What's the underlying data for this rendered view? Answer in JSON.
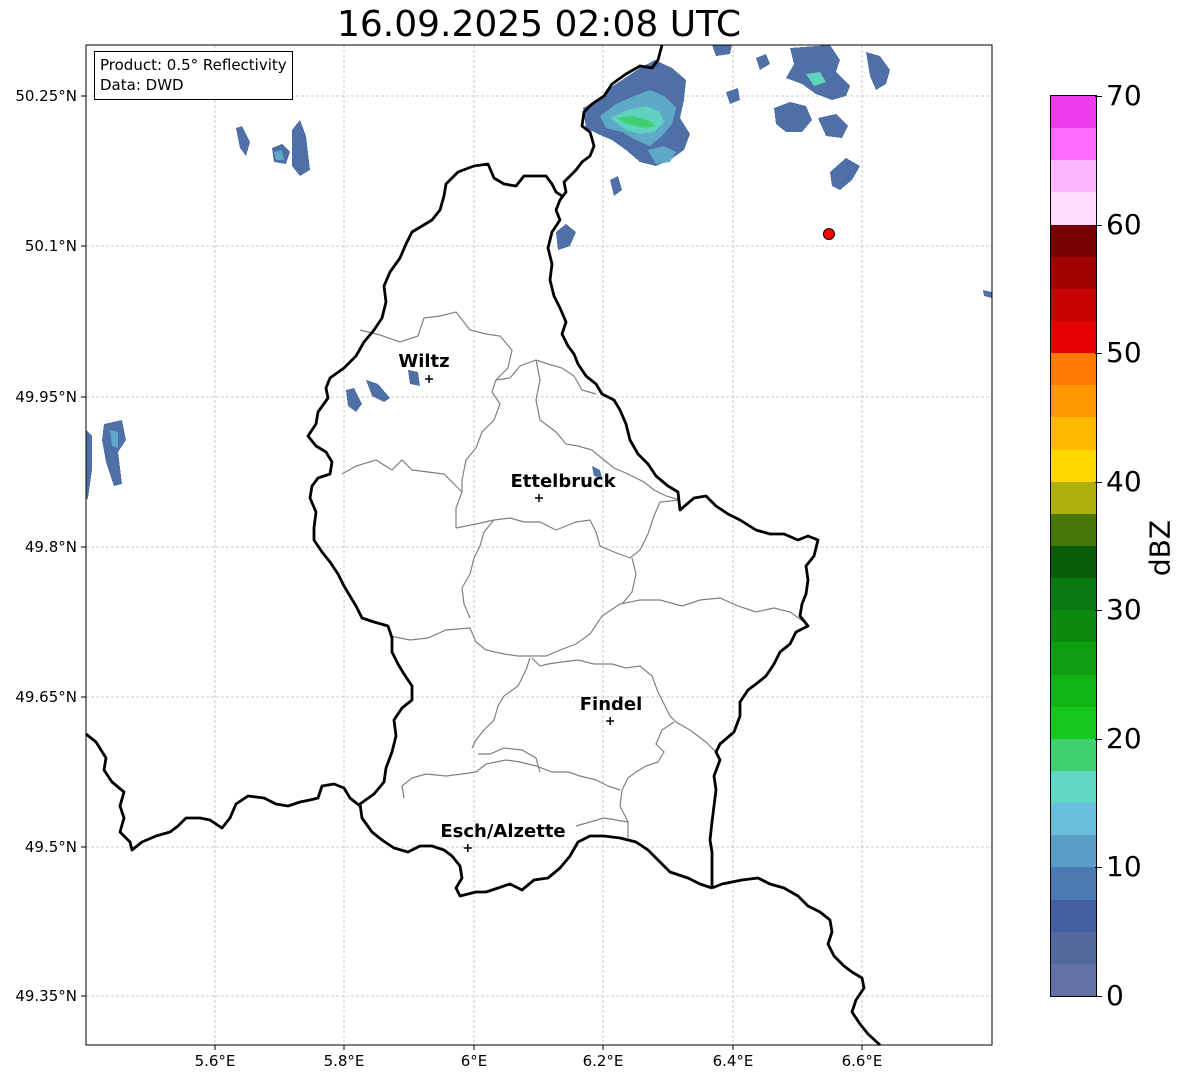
{
  "title": "16.09.2025 02:08 UTC",
  "info": {
    "product": "Product: 0.5° Reflectivity",
    "source": "Data: DWD"
  },
  "lat_ticks": [
    {
      "value": 50.25,
      "label": "50.25°N"
    },
    {
      "value": 50.1,
      "label": "50.1°N"
    },
    {
      "value": 49.95,
      "label": "49.95°N"
    },
    {
      "value": 49.8,
      "label": "49.8°N"
    },
    {
      "value": 49.65,
      "label": "49.65°N"
    },
    {
      "value": 49.5,
      "label": "49.5°N"
    },
    {
      "value": 49.35,
      "label": "49.35°N"
    }
  ],
  "lon_ticks": [
    {
      "value": 5.6,
      "label": "5.6°E"
    },
    {
      "value": 5.8,
      "label": "5.8°E"
    },
    {
      "value": 6.0,
      "label": "6°E"
    },
    {
      "value": 6.2,
      "label": "6.2°E"
    },
    {
      "value": 6.4,
      "label": "6.4°E"
    },
    {
      "value": 6.6,
      "label": "6.6°E"
    }
  ],
  "cities": [
    {
      "name": "Wiltz",
      "lon": 5.93,
      "lat": 49.966
    },
    {
      "name": "Ettelbruck",
      "lon": 6.1,
      "lat": 49.847
    },
    {
      "name": "Findel",
      "lon": 6.21,
      "lat": 49.624
    },
    {
      "name": "Esch/Alzette",
      "lon": 5.99,
      "lat": 49.497
    }
  ],
  "radar_site": {
    "lon": 6.548,
    "lat": 50.111,
    "color": "#ff0000"
  },
  "colorbar": {
    "label": "dBZ",
    "min": 0,
    "max": 70,
    "tick_values": [
      0,
      10,
      20,
      30,
      40,
      50,
      60,
      70
    ],
    "tick_labels": [
      "0",
      "10",
      "20",
      "30",
      "40",
      "50",
      "60",
      "70"
    ],
    "colors": [
      "#6272a6",
      "#526aa0",
      "#445fa0",
      "#4a78b0",
      "#5a9ec8",
      "#68c0dc",
      "#60d8c4",
      "#40d070",
      "#14c81e",
      "#10b414",
      "#0e9e12",
      "#0c8a10",
      "#0a7810",
      "#0a5c0a",
      "#48780a",
      "#b0b00a",
      "#ffd800",
      "#ffb800",
      "#ff9800",
      "#ff7800",
      "#e40000",
      "#c80000",
      "#a00000",
      "#780000",
      "#ffdcff",
      "#ffb4ff",
      "#ff6cff",
      "#ec3cec"
    ]
  },
  "map_extent": {
    "lon_min": 5.4,
    "lon_max": 6.8,
    "lat_min": 49.3,
    "lat_max": 50.3
  },
  "gridlines": "dashed light grey"
}
